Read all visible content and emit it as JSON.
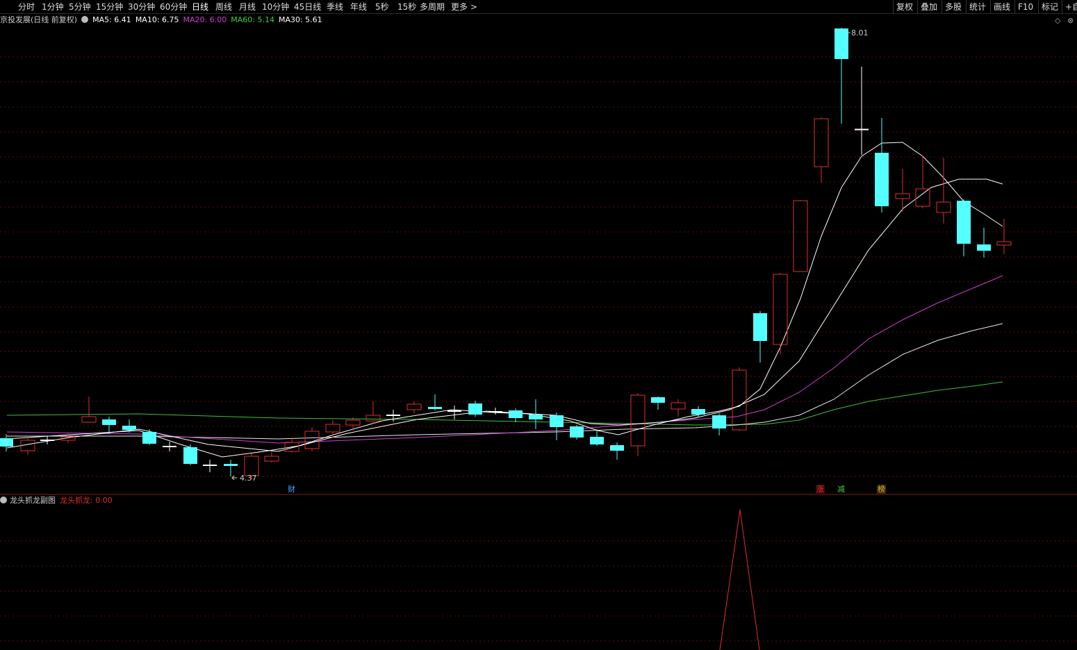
{
  "toolbar": {
    "timeframes": [
      "分时",
      "1分钟",
      "5分钟",
      "15分钟",
      "30分钟",
      "60分钟",
      "日线",
      "周线",
      "月线",
      "10分钟",
      "45日线",
      "季线",
      "年线",
      "5秒",
      "15秒",
      "多周期",
      "更多 >"
    ],
    "right_buttons": [
      "复权",
      "叠加",
      "多股",
      "统计",
      "画线",
      "F10",
      "标记",
      "+自"
    ]
  },
  "main_panel": {
    "title": "京投发展(日线 前复权)",
    "indicators": [
      {
        "label": "MA5: 6.41",
        "color": "#ffffff"
      },
      {
        "label": "MA10: 6.75",
        "color": "#ffffff"
      },
      {
        "label": "MA20: 6.00",
        "color": "#d040d0"
      },
      {
        "label": "MA60: 5.14",
        "color": "#40d040"
      },
      {
        "label": "MA30: 5.61",
        "color": "#ffffff"
      }
    ],
    "high_label": "8.01",
    "low_label": "4.37",
    "event_tags": [
      {
        "text": "财",
        "color": "#4aa8ff"
      },
      {
        "text": "涨",
        "color": "#e03030"
      },
      {
        "text": "减",
        "color": "#40d040"
      },
      {
        "text": "榜",
        "color": "#e0b030"
      }
    ]
  },
  "sub_panel": {
    "title": "龙头抓龙副图",
    "indicator": "龙头抓龙: 0.00"
  },
  "colors": {
    "up": "#e03030",
    "down": "#54ffff",
    "ma5": "#ffffff",
    "ma10": "#ffffff",
    "ma20": "#d040d0",
    "ma30": "#e8e8e8",
    "ma60": "#40c040"
  }
}
